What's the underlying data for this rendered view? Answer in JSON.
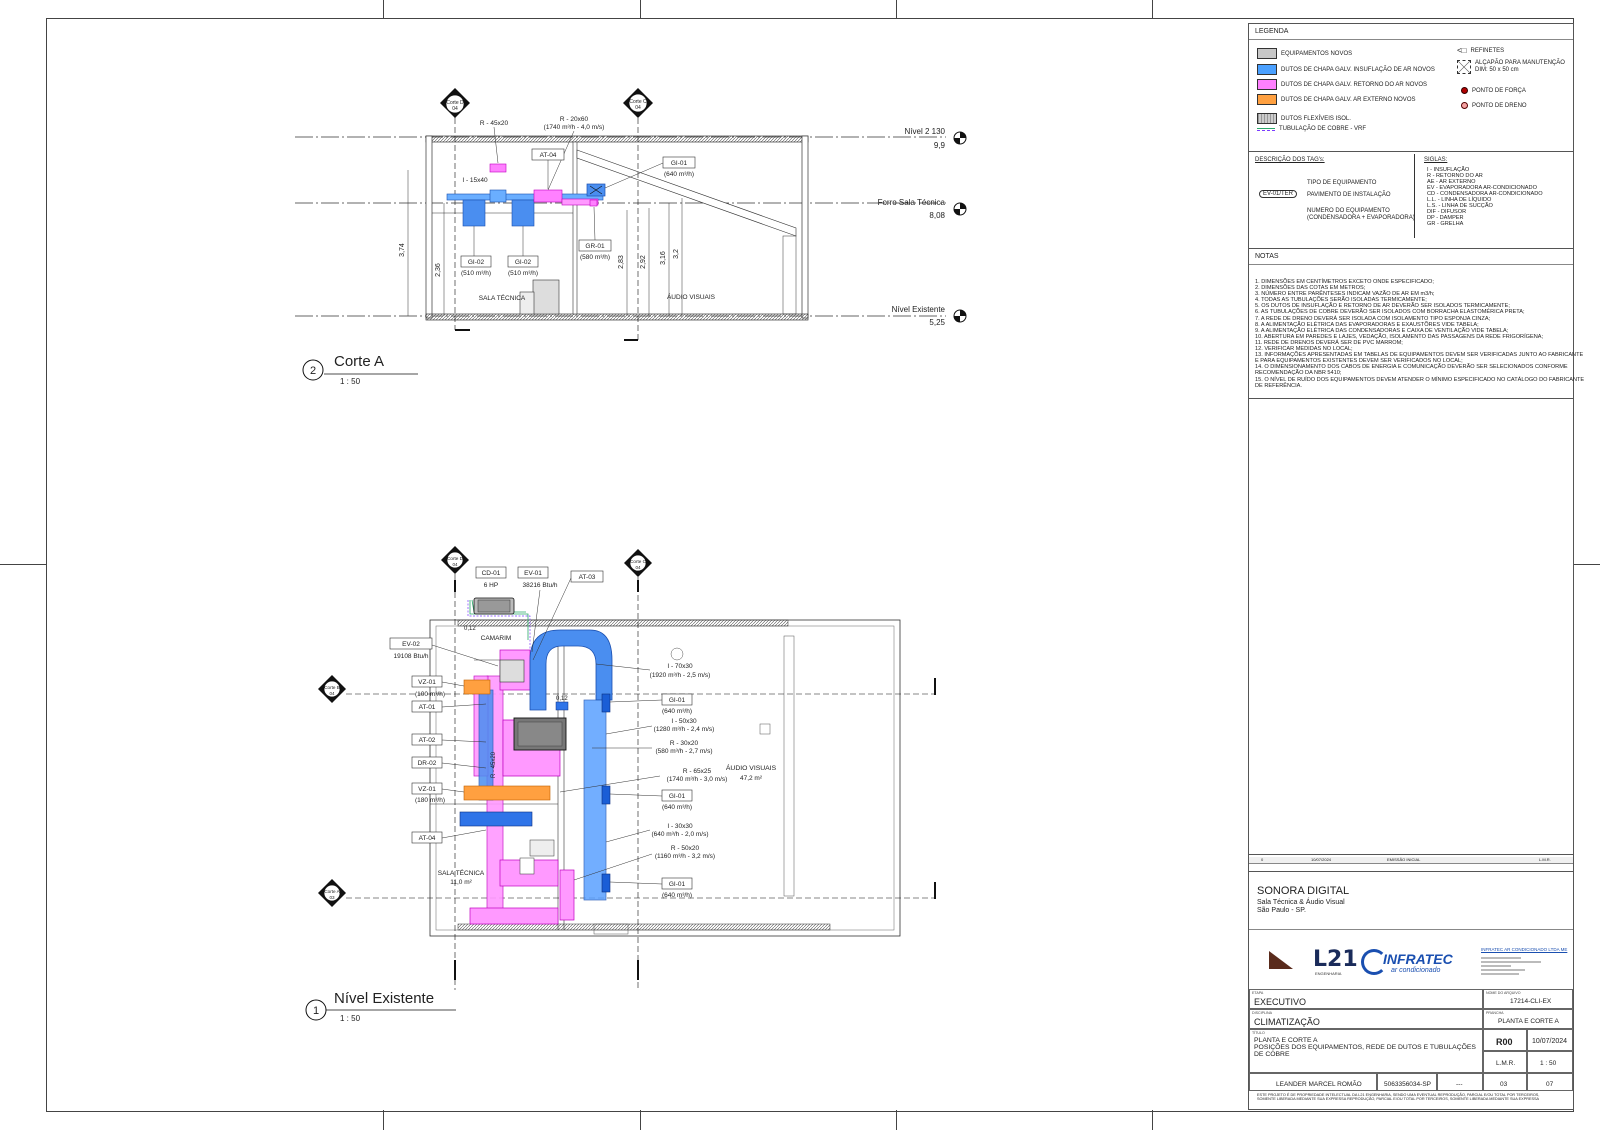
{
  "legend": {
    "title": "LEGENDA",
    "items": [
      {
        "label": "EQUIPAMENTOS NOVOS",
        "color": "#c8c8c8"
      },
      {
        "label": "DUTOS DE CHAPA GALV. INSUFLAÇÃO DE AR NOVOS",
        "color": "#4aa0ff"
      },
      {
        "label": "DUTOS DE CHAPA GALV. RETORNO DO AR NOVOS",
        "color": "#ff80ff"
      },
      {
        "label": "DUTOS DE CHAPA GALV. AR EXTERNO NOVOS",
        "color": "#ffa040"
      },
      {
        "label": "DUTOS FLEXÍVEIS ISOL.",
        "color": "#bbbbbb"
      },
      {
        "label": "TUBULAÇÃO DE COBRE - VRF",
        "color": "#2aa86a"
      }
    ],
    "right_items": [
      "REFINETES",
      "ALÇAPÃO PARA MANUTENÇÃO",
      "DIM: 50 x 50 cm",
      "PONTO DE FORÇA",
      "PONTO DE DRENO"
    ]
  },
  "tags": {
    "title": "DESCRIÇÃO DOS TAG's:",
    "sample": "EV-01/TER",
    "lines": [
      "TIPO DE EQUIPAMENTO",
      "PAVIMENTO DE INSTALAÇÃO",
      "NUMERO DO EQUIPAMENTO",
      "(CONDENSADORA + EVAPORADORA)"
    ]
  },
  "siglas": {
    "title": "SIGLAS:",
    "items": [
      "I - INSUFLAÇÃO",
      "R - RETORNO DO AR",
      "AE - AR EXTERNO",
      "EV - EVAPORADORA AR-CONDICIONADO",
      "CD - CONDENSADORA AR-CONDICIONADO",
      "L.L. - LINHA DE LÍQUIDO",
      "L.S. - LINHA DE SUCÇÃO",
      "DIF - DIFUSOR",
      "DP - DAMPER",
      "GR - GRELHA"
    ]
  },
  "notes": {
    "title": "NOTAS",
    "items": [
      "1.   DIMENSÕES EM CENTÍMETROS EXCETO ONDE ESPECIFICADO;",
      "2.   DIMENSÕES DAS COTAS EM METROS;",
      "3.   NÚMERO ENTRE PARÊNTESES INDICAM VAZÃO DE AR EM m3/h;",
      "4.   TODAS AS TUBULAÇÕES SERÃO ISOLADAS TERMICAMENTE;",
      "5.   OS DUTOS DE INSUFLAÇÃO E RETORNO DE AR DEVERÃO SER ISOLADOS TERMICAMENTE;",
      "6.   AS TUBULAÇÕES DE COBRE DEVERÃO SER ISOLADOS COM BORRACHA ELASTOMÉRICA PRETA;",
      "7.   A REDE DE DRENO DEVERÁ SER ISOLADA COM ISOLAMENTO TIPO ESPONJA CINZA;",
      "8.   A ALIMENTAÇÃO ELÉTRICA DAS EVAPORADORAS E EXAUSTÕRES VIDE TABELA;",
      "9.   A ALIMENTAÇÃO ELÉTRICA DAS CONDENSADORAS E CAIXA DE VENTILAÇÃO VIDE TABELA;",
      "10.  ABERTURA EM PAREDES E LAJES, VEDAÇÃO, ISOLAMENTO DAS PASSAGENS DA REDE FRIGORÍGENA;",
      "11.  REDE DE DRENOS DEVERÁ SER DE PVC MARROM;",
      "12.  VERIFICAR MEDIDAS NO LOCAL;",
      "13.  INFORMAÇÕES APRESENTADAS EM TABELAS DE EQUIPAMENTOS DEVEM SER VERIFICADAS JUNTO AO FABRICANTE",
      "      E  PARA EQUIPAMENTOS EXISTENTES DEVEM SER VERIFICADOS NO LOCAL;",
      "14.  O DIMENSIONAMENTO DOS CABOS DE ENERGIA E COMUNICAÇÃO DEVERÃO SER SELECIONADOS CONFORME",
      "      RECOMENDAÇÃO DA NBR 5410;",
      "15.  O NÍVEL DE RUÍDO DOS EQUIPAMENTOS DEVEM ATENDER O MÍNIMO ESPECIFICADO NO CATÁLOGO DO FABRICANTE",
      "      DE REFERÊNCIA."
    ]
  },
  "title_block": {
    "client": "SONORA DIGITAL",
    "location1": "Sala Técnica & Áudio Visual",
    "location2": "São Paulo - SP.",
    "logo1": "L21",
    "logo1_sub": "ENGENHARIA",
    "logo2": "INFRATEC",
    "logo2_sub": "ar condicionado",
    "company": "INFRATEC AR CONDICIONADO LTDA ME",
    "etapa_label": "ETAPA",
    "etapa": "EXECUTIVO",
    "disciplina_label": "DISCIPLINA",
    "disciplina": "CLIMATIZAÇÃO",
    "titulo_label": "TÍTULO",
    "titulo1": "PLANTA E CORTE A",
    "titulo2": "POSIÇÕES DOS EQUIPAMENTOS, REDE DE DUTOS E TUBULAÇÕES",
    "titulo3": "DE COBRE",
    "arquivo_label": "NOME DO ARQUIVO",
    "arquivo": "17214-CLI-EX",
    "prancha_label": "PRANCHA",
    "prancha": "PLANTA E CORTE A",
    "revisao": "R00",
    "data": "10/07/2024",
    "projetista": "L.M.R.",
    "escala": "1 : 50",
    "responsavel": "LEANDER MARCEL ROMÃO",
    "crea": "5063356034-SP",
    "art": "---",
    "folha": "03",
    "total": "07",
    "footer1": "ESTE PROJETO É DE PROPRIEDADE INTELECTUAL DA L21 ENGENHARIA, SENDO UMA EVENTUAL REPRODUÇÃO, PARCIAL E/OU TOTAL POR TERCEIROS,",
    "footer2": "SOMENTE LIBERADA MEDIANTE SUA EXPRESSA REPRODUÇÃO, PARCIAL E/OU TOTAL POR TERCEIROS, SOMENTE LIBERADA MEDIANTE SUA EXPRESSA",
    "rev_row": [
      "0",
      "10/07/2024",
      "EMISSÃO INICIAL",
      "L.M.R."
    ]
  },
  "corte": {
    "title": "Corte A",
    "number": "2",
    "scale": "1 : 50",
    "levels": [
      {
        "name": "Nível 2 130",
        "value": "9,9"
      },
      {
        "name": "Forro Sala Técnica",
        "value": "8,08"
      },
      {
        "name": "Nível Existente",
        "value": "5,25"
      }
    ],
    "tags": {
      "r1": "R - 45x20",
      "r2": "R - 20x60",
      "r2b": "(1740 m³/h - 4,0 m/s)",
      "i1": "I - 15x40",
      "at04": "AT-04",
      "gi01": "GI-01",
      "gi01b": "(640 m³/h)",
      "gi02a": "GI-02",
      "gi02ab": "(510 m³/h)",
      "gi02b": "GI-02",
      "gi02bb": "(510 m³/h)",
      "gr01": "GR-01",
      "gr01b": "(580 m³/h)"
    },
    "dims": [
      "3,74",
      "2,36",
      "2,83",
      "2,92",
      "3,16",
      "3,2"
    ],
    "rooms": [
      "SALA TÉCNICA",
      "ÁUDIO VISUAIS"
    ],
    "section_marks": [
      {
        "name": "Corte D",
        "sheet": "04"
      },
      {
        "name": "Corte C",
        "sheet": "04"
      }
    ]
  },
  "planta": {
    "title": "Nível Existente",
    "number": "1",
    "scale": "1 : 50",
    "tags": {
      "cd01": "CD-01",
      "cd01b": "6 HP",
      "ev01": "EV-01",
      "ev01b": "38216 Btu/h",
      "at03": "AT-03",
      "ev02": "EV-02",
      "ev02b": "19108 Btu/h",
      "vz01a": "VZ-01",
      "vz01ab": "(100 m³/h)",
      "at01": "AT-01",
      "at02": "AT-02",
      "dr02": "DR-02",
      "vz01b": "VZ-01",
      "vz01bb": "(180 m³/h)",
      "at04": "AT-04",
      "i70": "I - 70x30",
      "i70b": "(1920 m³/h - 2,5 m/s)",
      "gi01a": "GI-01",
      "gi01ab": "(640 m³/h)",
      "i50": "I - 50x30",
      "i50b": "(1280 m³/h - 2,4 m/s)",
      "r30": "R - 30x20",
      "r30b": "(580 m³/h - 2,7 m/s)",
      "r65": "R - 65x25",
      "r65b": "(1740 m³/h - 3,0 m/s)",
      "gi01b": "GI-01",
      "gi01bb": "(640 m³/h)",
      "i30": "I - 30x30",
      "i30b": "(640 m³/h - 2,0 m/s)",
      "r50": "R - 50x20",
      "r50b": "(1160 m³/h - 3,2 m/s)",
      "gi01c": "GI-01",
      "gi01cb": "(640 m³/h)",
      "duct": "R - 45x20",
      "dim1": "0,12",
      "dim2": "0,12"
    },
    "rooms": [
      {
        "name": "CAMARIM"
      },
      {
        "name": "ÁUDIO VISUAIS",
        "area": "47,2 m²"
      },
      {
        "name": "SALA TÉCNICA",
        "area": "11,0 m²"
      }
    ],
    "section_marks": [
      {
        "name": "Corte D",
        "sheet": "04"
      },
      {
        "name": "Corte C",
        "sheet": "04"
      },
      {
        "name": "Corte B",
        "sheet": "04"
      },
      {
        "name": "Corte A",
        "sheet": "03"
      }
    ]
  }
}
